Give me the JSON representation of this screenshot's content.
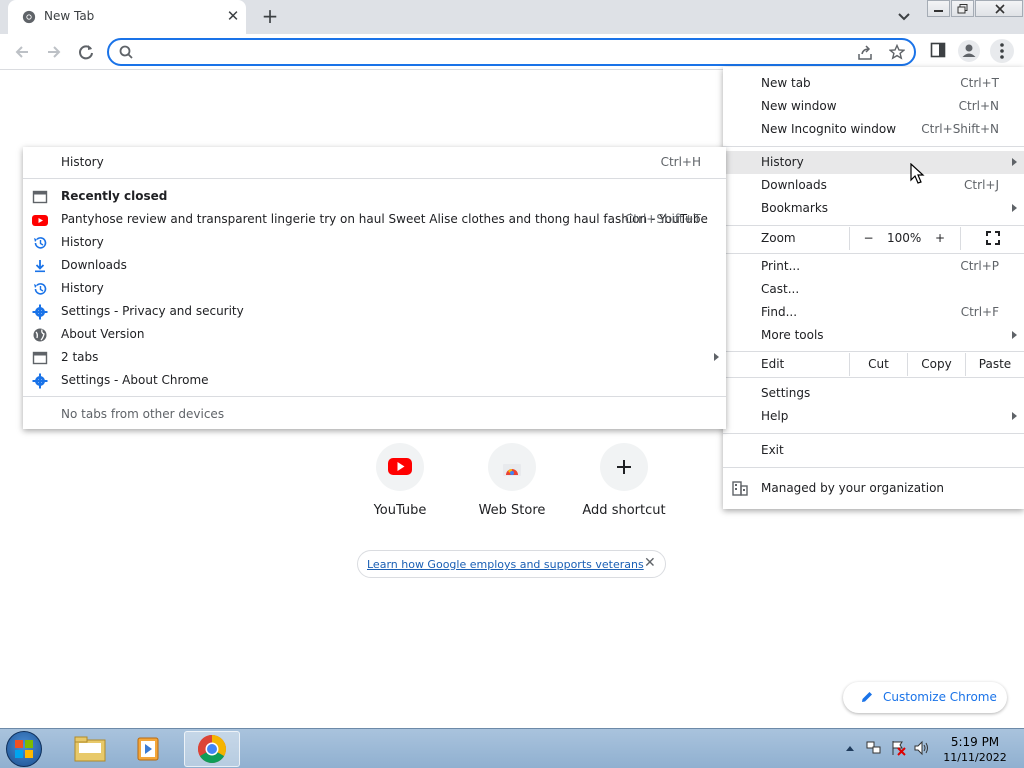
{
  "tab": {
    "title": "New Tab",
    "close_glyph": "✕"
  },
  "newtab_glyph": "+",
  "omnibox": {
    "value": "",
    "placeholder": ""
  },
  "ntp": {
    "shortcuts": [
      {
        "label": "YouTube",
        "icon": "youtube-icon"
      },
      {
        "label": "Web Store",
        "icon": "webstore-icon"
      },
      {
        "label": "Add shortcut",
        "icon": "plus-icon"
      }
    ],
    "promo_text": "Learn how Google employs and supports veterans",
    "promo_close": "✕",
    "customize_label": "Customize Chrome"
  },
  "main_menu": {
    "new_tab": {
      "label": "New tab",
      "shortcut": "Ctrl+T"
    },
    "new_window": {
      "label": "New window",
      "shortcut": "Ctrl+N"
    },
    "new_incognito": {
      "label": "New Incognito window",
      "shortcut": "Ctrl+Shift+N"
    },
    "history": {
      "label": "History"
    },
    "downloads": {
      "label": "Downloads",
      "shortcut": "Ctrl+J"
    },
    "bookmarks": {
      "label": "Bookmarks"
    },
    "zoom": {
      "label": "Zoom",
      "minus": "−",
      "value": "100%",
      "plus": "+"
    },
    "print": {
      "label": "Print...",
      "shortcut": "Ctrl+P"
    },
    "cast": {
      "label": "Cast..."
    },
    "find": {
      "label": "Find...",
      "shortcut": "Ctrl+F"
    },
    "more_tools": {
      "label": "More tools"
    },
    "edit": {
      "label": "Edit",
      "cut": "Cut",
      "copy": "Copy",
      "paste": "Paste"
    },
    "settings": {
      "label": "Settings"
    },
    "help": {
      "label": "Help"
    },
    "exit": {
      "label": "Exit"
    },
    "managed": {
      "label": "Managed by your organization"
    }
  },
  "history_menu": {
    "history": {
      "label": "History",
      "shortcut": "Ctrl+H"
    },
    "recently_closed": "Recently closed",
    "items": [
      {
        "label": "Pantyhose review and transparent lingerie try on haul Sweet Alise clothes and thong haul fashion - YouTube",
        "shortcut": "Ctrl+Shift+T",
        "icon": "youtube-favicon-icon"
      },
      {
        "label": "History",
        "icon": "history-icon"
      },
      {
        "label": "Downloads",
        "icon": "download-icon"
      },
      {
        "label": "History",
        "icon": "history-icon"
      },
      {
        "label": "Settings - Privacy and security",
        "icon": "settings-gear-icon"
      },
      {
        "label": "About Version",
        "icon": "globe-icon"
      },
      {
        "label": "2 tabs",
        "icon": "tab-window-icon"
      },
      {
        "label": "Settings - About Chrome",
        "icon": "settings-gear-icon"
      }
    ],
    "no_tabs": "No tabs from other devices"
  },
  "taskbar": {
    "time": "5:19 PM",
    "date": "11/11/2022"
  },
  "colors": {
    "accent": "#1a73e8",
    "tabstrip": "#dee1e6",
    "menu_hover": "#e8e8e9",
    "youtube_red": "#ff0000"
  }
}
